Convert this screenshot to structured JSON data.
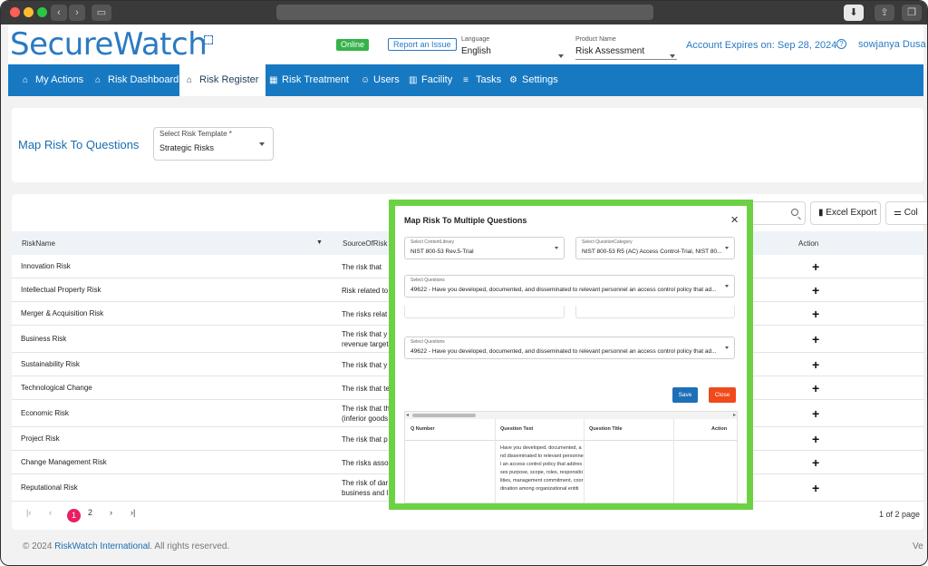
{
  "header": {
    "logo": "SecureWatch",
    "online_badge": "Online",
    "report_issue": "Report an Issue",
    "language_label": "Language",
    "language_value": "English",
    "product_label": "Product Name",
    "product_value": "Risk Assessment",
    "account_expires": "Account Expires on: Sep 28, 2024",
    "username": "sowjanya Dusa"
  },
  "nav": {
    "items": [
      {
        "label": "My Actions",
        "icon": "home-icon"
      },
      {
        "label": "Risk Dashboard",
        "icon": "home-icon"
      },
      {
        "label": "Risk Register",
        "icon": "bank-icon"
      },
      {
        "label": "Risk Treatment",
        "icon": "table-icon"
      },
      {
        "label": "Users",
        "icon": "users-icon"
      },
      {
        "label": "Facility",
        "icon": "building-icon"
      },
      {
        "label": "Tasks",
        "icon": "list-icon"
      },
      {
        "label": "Settings",
        "icon": "gear-icon"
      }
    ],
    "active": "Risk Register"
  },
  "map_section": {
    "title": "Map Risk To Questions",
    "template_label": "Select Risk Template *",
    "template_value": "Strategic Risks"
  },
  "toolbar": {
    "excel_export": "Excel Export",
    "columns": "Col"
  },
  "table": {
    "headers": [
      "RiskName",
      "SourceOfRisk",
      "Action"
    ],
    "rows": [
      {
        "name": "Innovation Risk",
        "source": [
          "The risk that"
        ]
      },
      {
        "name": "Intellectual Property Risk",
        "source": [
          "Risk related to"
        ]
      },
      {
        "name": "Merger & Acquisition Risk",
        "source": [
          "The risks relat"
        ]
      },
      {
        "name": "Business Risk",
        "source": [
          "The risk that y",
          "revenue target"
        ]
      },
      {
        "name": "Sustainability Risk",
        "source": [
          "The risk that y"
        ]
      },
      {
        "name": "Technological Change",
        "source": [
          "The risk that te"
        ]
      },
      {
        "name": "Economic Risk",
        "source": [
          "The risk that th",
          "(inferior goods"
        ]
      },
      {
        "name": "Project Risk",
        "source": [
          "The risk that p"
        ]
      },
      {
        "name": "Change Management Risk",
        "source": [
          "The risks asso"
        ]
      },
      {
        "name": "Reputational Risk",
        "source": [
          "The risk of dar",
          "business and l"
        ]
      }
    ],
    "action_symbol": "+"
  },
  "pagination": {
    "first": "|‹",
    "prev": "‹",
    "pages": [
      "1",
      "2"
    ],
    "next": "›",
    "last": "›|",
    "summary": "1 of 2 page"
  },
  "footer": {
    "copyright_prefix": "© 2024 ",
    "company": "RiskWatch International",
    "copyright_suffix": ". All rights reserved.",
    "version_prefix": "Ve"
  },
  "modal": {
    "title": "Map Risk To Multiple Questions",
    "content_library_label": "Select ContentLibrary",
    "content_library_value": "NIST 800-53 Rev.5-Trial",
    "question_category_label": "Select QuestionCategory",
    "question_category_value": "NIST 800-53 R5 (AC) Access Control-Trial, NIST 80...",
    "questions_label": "Select Questions",
    "questions_value": "49622 - Have you developed, documented, and disseminated to relevant personnel an access control policy that ad...",
    "questions_label_2": "Select Questions",
    "questions_value_2": "49622 - Have you developed, documented, and disseminated to relevant personnel an access control policy that ad...",
    "save": "Save",
    "close": "Close",
    "table_headers": [
      "Q Number",
      "Question Text",
      "Question Title",
      "Action"
    ],
    "question_text": "Have you developed, documented, and disseminated to relevant personnel an access control policy that addresses purpose, scope, roles, responsibilities, management commitment, coordination among organizational entiti"
  },
  "colors": {
    "brand_blue": "#1779c2",
    "highlight_green": "#6cd244",
    "pager_active": "#e91e63",
    "close_button": "#f04a1c",
    "save_button": "#1d6fb7"
  }
}
